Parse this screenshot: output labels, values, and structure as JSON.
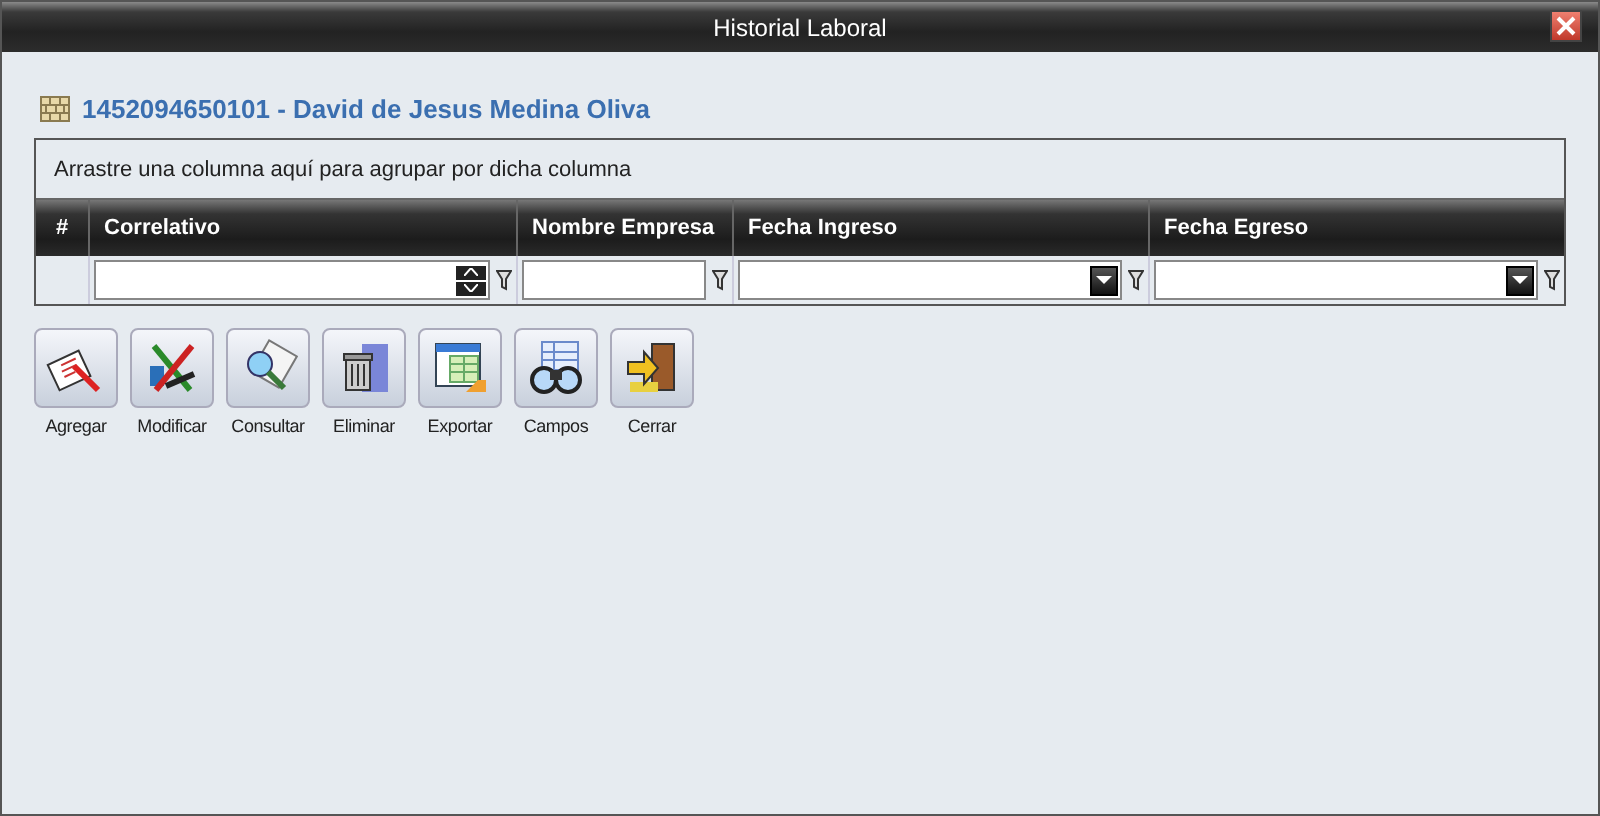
{
  "window": {
    "title": "Historial Laboral"
  },
  "record_title": "1452094650101 - David de Jesus Medina Oliva",
  "grid": {
    "group_hint": "Arrastre una columna aquí para agrupar por dicha columna",
    "columns": [
      {
        "label": "#",
        "kind": "index"
      },
      {
        "label": "Correlativo",
        "kind": "number"
      },
      {
        "label": "Nombre Empresa",
        "kind": "text"
      },
      {
        "label": "Fecha Ingreso",
        "kind": "date"
      },
      {
        "label": "Fecha Egreso",
        "kind": "date"
      }
    ]
  },
  "toolbar": [
    {
      "label": "Agregar",
      "kind": "add"
    },
    {
      "label": "Modificar",
      "kind": "edit"
    },
    {
      "label": "Consultar",
      "kind": "view"
    },
    {
      "label": "Eliminar",
      "kind": "delete"
    },
    {
      "label": "Exportar",
      "kind": "export"
    },
    {
      "label": "Campos",
      "kind": "fields"
    },
    {
      "label": "Cerrar",
      "kind": "close"
    }
  ]
}
